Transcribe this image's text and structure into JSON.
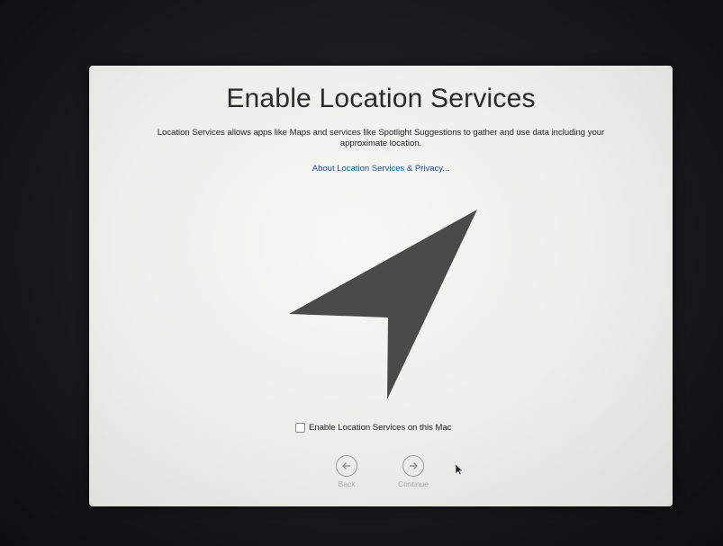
{
  "setup": {
    "title": "Enable Location Services",
    "description": "Location Services allows apps like Maps and services like Spotlight Suggestions to gather and use data including your approximate location.",
    "privacy_link": "About Location Services & Privacy...",
    "hero_icon": "location-arrow-icon",
    "checkbox": {
      "label": "Enable Location Services on this Mac",
      "checked": false
    },
    "nav": {
      "back_label": "Back",
      "back_icon": "arrow-left-circle-icon",
      "continue_label": "Continue",
      "continue_icon": "arrow-right-circle-icon"
    }
  },
  "colors": {
    "arrow": "#4a4a4a",
    "link": "#1f4fa8",
    "disabled_text": "#a8a8a8"
  }
}
